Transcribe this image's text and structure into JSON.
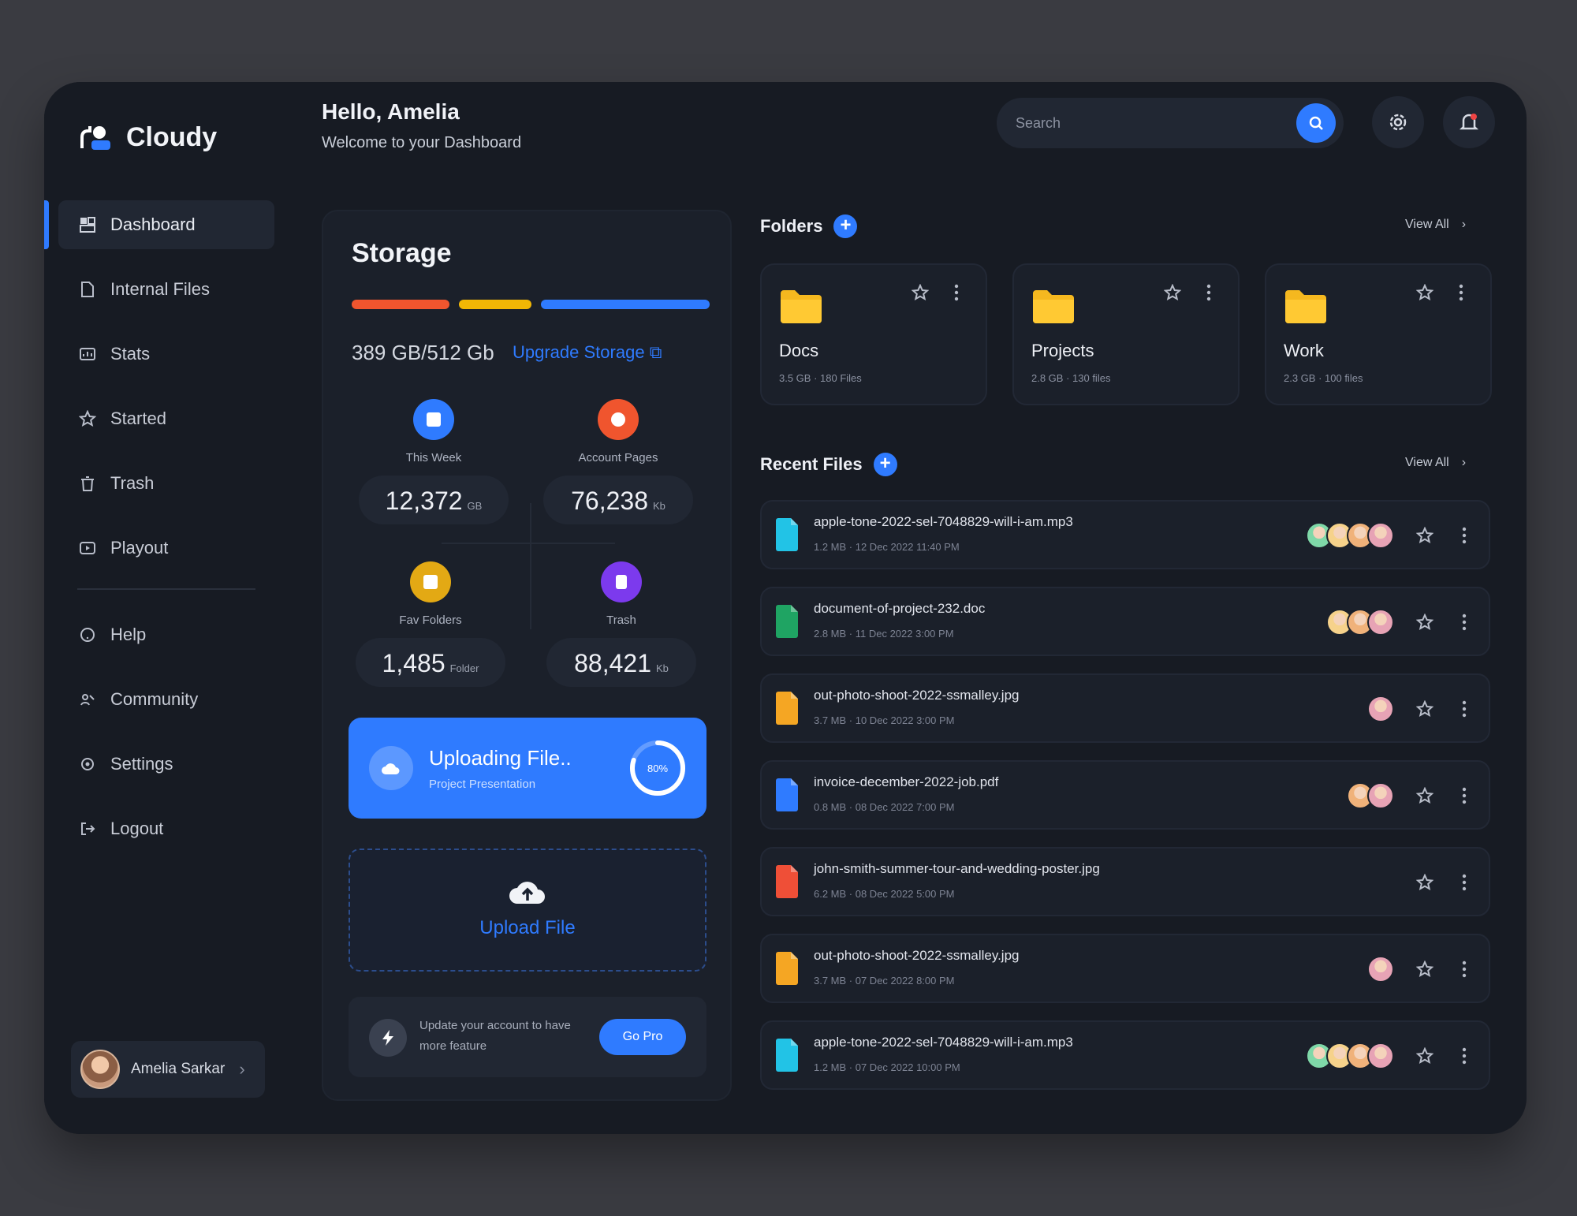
{
  "brand": {
    "name": "Cloudy"
  },
  "header": {
    "hello": "Hello, Amelia",
    "subtitle": "Welcome to your Dashboard",
    "search_placeholder": "Search"
  },
  "sidebar": {
    "items": [
      {
        "label": "Dashboard",
        "icon": "dashboard-icon",
        "active": true
      },
      {
        "label": "Internal Files",
        "icon": "file-icon"
      },
      {
        "label": "Stats",
        "icon": "stats-icon"
      },
      {
        "label": "Started",
        "icon": "star-icon"
      },
      {
        "label": "Trash",
        "icon": "trash-icon"
      },
      {
        "label": "Playout",
        "icon": "play-icon"
      }
    ],
    "bottom_items": [
      {
        "label": "Help",
        "icon": "help-icon"
      },
      {
        "label": "Community",
        "icon": "community-icon"
      },
      {
        "label": "Settings",
        "icon": "settings-icon"
      },
      {
        "label": "Logout",
        "icon": "logout-icon"
      }
    ],
    "user": {
      "name": "Amelia Sarkar"
    }
  },
  "storage": {
    "title": "Storage",
    "used": "389 GB/512 Gb",
    "upgrade_label": "Upgrade Storage",
    "bar_colors": [
      "#f0552e",
      "#f2b705",
      "#2f7bff"
    ],
    "stats": [
      {
        "label": "This Week",
        "value": "12,372",
        "unit": "GB",
        "color": "#2f7bff"
      },
      {
        "label": "Account Pages",
        "value": "76,238",
        "unit": "Kb",
        "color": "#f0552e"
      },
      {
        "label": "Fav Folders",
        "value": "1,485",
        "unit": "Folder",
        "color": "#e3a914"
      },
      {
        "label": "Trash",
        "value": "88,421",
        "unit": "Kb",
        "color": "#7c3aed"
      }
    ],
    "uploading": {
      "title": "Uploading File..",
      "subtitle": "Project Presentation",
      "percent": 80,
      "percent_label": "80%"
    },
    "upload_label": "Upload File",
    "promo": {
      "text": "Update your account to have more feature",
      "button": "Go Pro"
    }
  },
  "folders": {
    "title": "Folders",
    "view_all": "View All",
    "items": [
      {
        "name": "Docs",
        "meta": "3.5 GB · 180 Files"
      },
      {
        "name": "Projects",
        "meta": "2.8 GB · 130 files"
      },
      {
        "name": "Work",
        "meta": "2.3 GB · 100 files"
      }
    ]
  },
  "recent": {
    "title": "Recent Files",
    "view_all": "View All",
    "files": [
      {
        "name": "apple-tone-2022-sel-7048829-will-i-am.mp3",
        "meta": "1.2 MB · 12 Dec 2022 11:40 PM",
        "color": "#22c3e6",
        "avatars": 4
      },
      {
        "name": "document-of-project-232.doc",
        "meta": "2.8 MB · 11 Dec 2022 3:00 PM",
        "color": "#1fa463",
        "avatars": 3
      },
      {
        "name": "out-photo-shoot-2022-ssmalley.jpg",
        "meta": "3.7 MB · 10 Dec 2022 3:00 PM",
        "color": "#f5a623",
        "avatars": 1
      },
      {
        "name": "invoice-december-2022-job.pdf",
        "meta": "0.8 MB · 08 Dec 2022 7:00 PM",
        "color": "#2f7bff",
        "avatars": 2
      },
      {
        "name": "john-smith-summer-tour-and-wedding-poster.jpg",
        "meta": "6.2 MB · 08 Dec 2022 5:00 PM",
        "color": "#ef4f37",
        "avatars": 0
      },
      {
        "name": "out-photo-shoot-2022-ssmalley.jpg",
        "meta": "3.7 MB · 07 Dec 2022 8:00 PM",
        "color": "#f5a623",
        "avatars": 1
      },
      {
        "name": "apple-tone-2022-sel-7048829-will-i-am.mp3",
        "meta": "1.2 MB · 07 Dec 2022 10:00 PM",
        "color": "#22c3e6",
        "avatars": 4
      }
    ]
  }
}
